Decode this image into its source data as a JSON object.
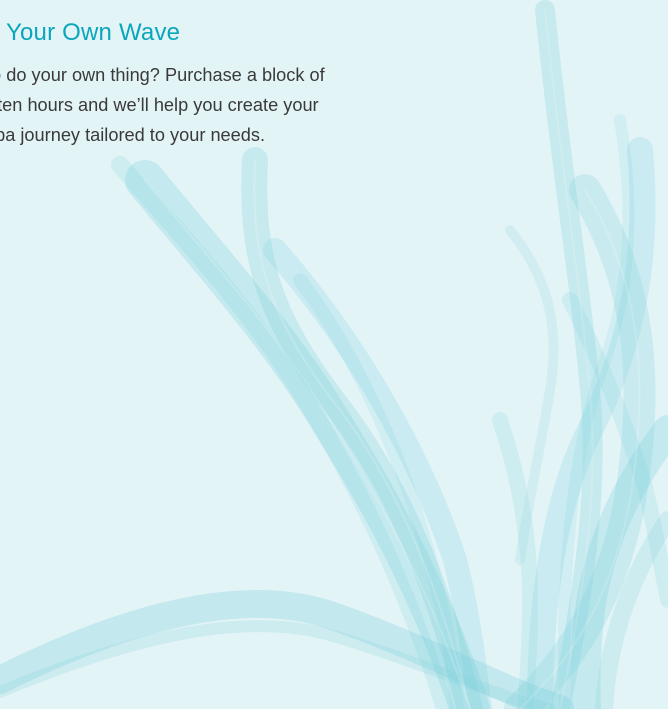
{
  "theme": {
    "background": "#e3f4f7",
    "accent": "#0aa6bb",
    "text": "#3a3a3a",
    "wave": "#7fd0dc"
  },
  "section": {
    "heading": "e Your Own Wave",
    "body_lines": [
      "to do your own thing? Purchase a block of",
      "r ten hours and we’ll help you create your",
      "spa journey tailored to your needs."
    ]
  },
  "decoration": {
    "icon": "seaweed-wave-illustration"
  }
}
